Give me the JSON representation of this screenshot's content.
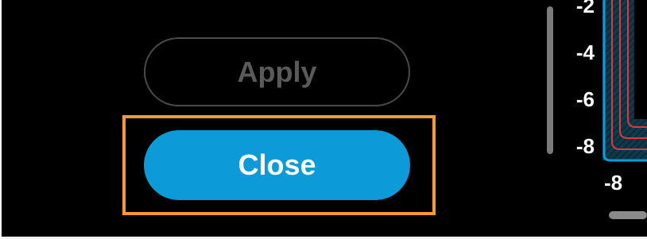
{
  "dialog": {
    "apply_label": "Apply",
    "close_label": "Close"
  },
  "chart_data": {
    "type": "heatmap",
    "y_tick_labels": [
      "-2",
      "-4",
      "-6",
      "-8"
    ],
    "x_tick_labels": [
      "-8"
    ],
    "colors": {
      "fill": "#0b3a4f",
      "contour_blue": "#0b9bd9",
      "contour_red": "#d93a3a"
    }
  },
  "colors": {
    "primary_button": "#0b9bd9",
    "focus_outline": "#f59a3a",
    "disabled_text": "#5a5a5a"
  }
}
